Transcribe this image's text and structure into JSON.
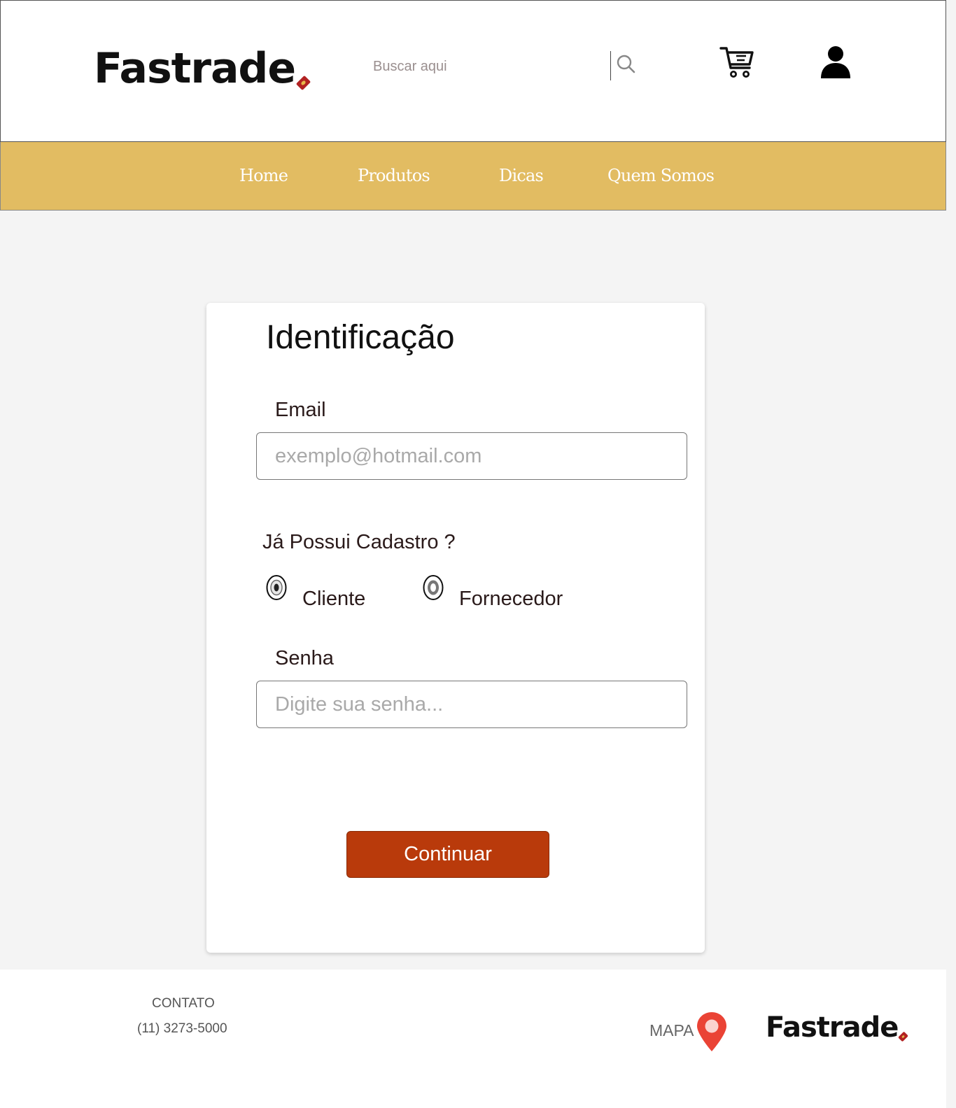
{
  "header": {
    "logo": "Fastrade",
    "search_placeholder": "Buscar aqui"
  },
  "nav": {
    "items": [
      "Home",
      "Produtos",
      "Dicas",
      "Quem Somos"
    ]
  },
  "form": {
    "title": "Identificação",
    "email_label": "Email",
    "email_placeholder": "exemplo@hotmail.com",
    "question": "Já Possui Cadastro ?",
    "options": [
      "Cliente",
      "Fornecedor"
    ],
    "password_label": "Senha",
    "password_placeholder": "Digite sua senha...",
    "submit_label": "Continuar"
  },
  "footer": {
    "contact_title": "CONTATO",
    "contact_phone": "(11) 3273-5000",
    "map_label": "MAPA",
    "logo": "Fastrade"
  },
  "colors": {
    "nav_background": "#e2bc62",
    "button": "#b93a0b",
    "pin": "#ea4335",
    "logo_tag": "#b22222"
  },
  "icons": [
    "search-icon",
    "cart-icon",
    "user-icon",
    "map-pin-icon"
  ]
}
